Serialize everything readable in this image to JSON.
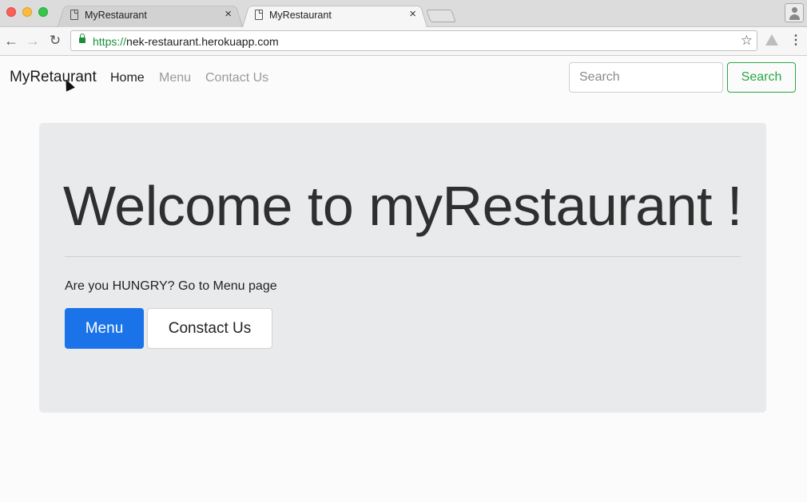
{
  "browser": {
    "tabs": [
      {
        "title": "MyRestaurant",
        "active": false
      },
      {
        "title": "MyRestaurant",
        "active": true
      }
    ],
    "url_scheme": "https://",
    "url_rest": "nek-restaurant.herokuapp.com",
    "tab_close_symbol": "×"
  },
  "navbar": {
    "brand": "MyRetaurant",
    "links": [
      "Home",
      "Menu",
      "Contact Us"
    ],
    "search_placeholder": "Search",
    "search_button": "Search"
  },
  "jumbotron": {
    "heading": "Welcome to myRestaurant !",
    "lead": "Are you HUNGRY? Go to Menu page",
    "primary_button": "Menu",
    "secondary_button": "Constact Us"
  },
  "colors": {
    "primary": "#1a73e8",
    "success": "#28a745",
    "jumbotron_bg": "#e9eaec"
  }
}
